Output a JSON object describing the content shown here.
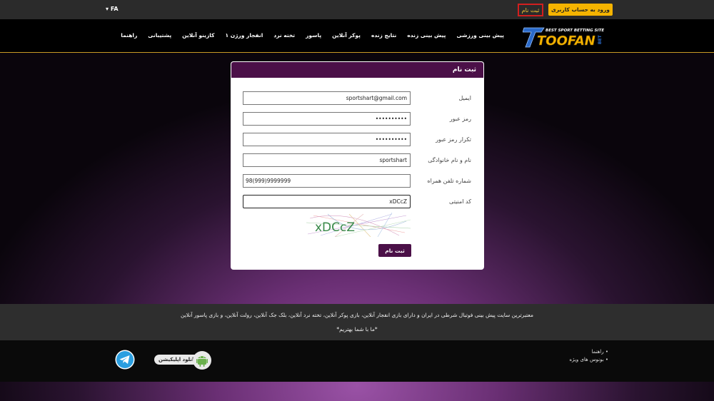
{
  "topbar": {
    "language": "FA",
    "register_label": "ثبت نام",
    "login_label": "ورود به حساب کاربری"
  },
  "logo": {
    "tagline": "BEST SPORT BETTING SITE",
    "brand": "TOOFAN",
    "suffix": "BET"
  },
  "nav": {
    "items": [
      "پیش بینی ورزشی",
      "پیش بینی زنده",
      "نتایج زنده",
      "پوکر آنلاین",
      "پاسور",
      "تخته نرد",
      "انفجار ورژن ۱",
      "کازینو آنلاین",
      "پشتیبانی",
      "راهنما"
    ]
  },
  "form": {
    "title": "ثبت نام",
    "email_label": "ایمیل",
    "email_value": "sportshart@gmail.com",
    "password_label": "رمز عبور",
    "password_value": "••••••••••",
    "password_repeat_label": "تکرار رمز عبور",
    "password_repeat_value": "••••••••••",
    "fullname_label": "نام و نام خانوادگی",
    "fullname_value": "sportshart",
    "phone_label": "شماره تلفن همراه",
    "phone_value": "98(999)9999999",
    "captcha_label": "کد امنیتی",
    "captcha_value": "xDCcZ",
    "captcha_image_text": "xDCcZ",
    "submit_label": "ثبت نام"
  },
  "strip": {
    "description": "معتبرترین سایت پیش بینی فوتبال شرطی در ایران و دارای بازی انفجار آنلاین، بازی پوکر آنلاین، تخته نرد آنلاین، بلک جک آنلاین، رولت آنلاین، و بازی پاسور آنلاین",
    "slogan": "*ما با شما بهتریم*"
  },
  "footer": {
    "links": [
      "• راهنما",
      "• بونوس های ویژه"
    ],
    "app_label": "دانلود اپلیکیشن"
  },
  "colors": {
    "accent": "#4b1048",
    "login_button": "#f5b400",
    "register_border": "#d21f1f",
    "gold_line": "#c79a25"
  }
}
